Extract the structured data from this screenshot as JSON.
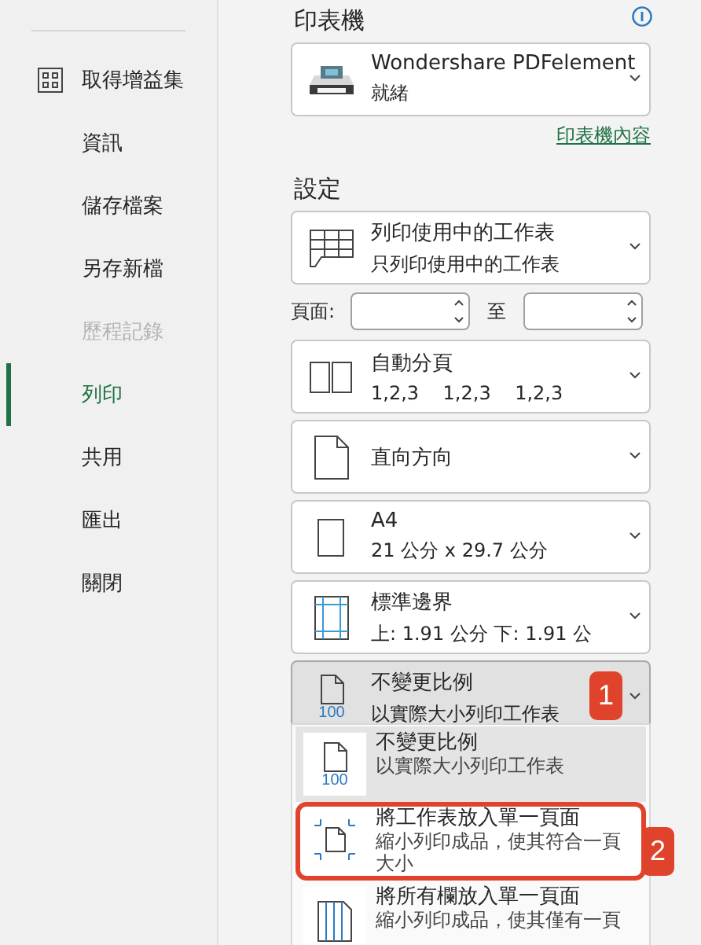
{
  "sidebar": {
    "items": [
      {
        "label": "取得增益集",
        "kind": "addins",
        "selected": false,
        "disabled": false
      },
      {
        "label": "資訊",
        "kind": "plain",
        "selected": false,
        "disabled": false
      },
      {
        "label": "儲存檔案",
        "kind": "plain",
        "selected": false,
        "disabled": false
      },
      {
        "label": "另存新檔",
        "kind": "plain",
        "selected": false,
        "disabled": false
      },
      {
        "label": "歷程記錄",
        "kind": "plain",
        "selected": false,
        "disabled": true
      },
      {
        "label": "列印",
        "kind": "plain",
        "selected": true,
        "disabled": false
      },
      {
        "label": "共用",
        "kind": "plain",
        "selected": false,
        "disabled": false
      },
      {
        "label": "匯出",
        "kind": "plain",
        "selected": false,
        "disabled": false
      },
      {
        "label": "關閉",
        "kind": "plain",
        "selected": false,
        "disabled": false
      }
    ]
  },
  "printer": {
    "heading": "印表機",
    "name": "Wondershare PDFelement",
    "status": "就緒",
    "link": "印表機內容"
  },
  "settings": {
    "heading": "設定",
    "rows": [
      {
        "kind": "dropdown",
        "title": "列印使用中的工作表",
        "subtitle": "只列印使用中的工作表",
        "pressed": false
      },
      {
        "kind": "pages",
        "label": "頁面:",
        "to": "至"
      },
      {
        "kind": "dropdown",
        "title": "自動分頁",
        "subtitle": "1,2,3    1,2,3    1,2,3",
        "pressed": false
      },
      {
        "kind": "dropdown",
        "title": "直向方向",
        "pressed": false
      },
      {
        "kind": "dropdown",
        "title": "A4",
        "subtitle": "21 公分 x 29.7 公分",
        "pressed": false
      },
      {
        "kind": "dropdown",
        "title": "標準邊界",
        "subtitle": "上: 1.91 公分 下: 1.91 公",
        "pressed": false
      },
      {
        "kind": "dropdown",
        "icon_label": "100",
        "title": "不變更比例",
        "subtitle": "以實際大小列印工作表",
        "pressed": true,
        "callout": "1"
      }
    ]
  },
  "menu": {
    "items": [
      {
        "icon_label": "100",
        "title": "不變更比例",
        "description": "以實際大小列印工作表",
        "selected": true,
        "highlight": false
      },
      {
        "title": "將工作表放入單一頁面",
        "description": "縮小列印成品，使其符合一頁大小",
        "selected": false,
        "highlight": true,
        "callout": "2"
      },
      {
        "title": "將所有欄放入單一頁面",
        "description": "縮小列印成品，使其僅有一頁",
        "selected": false,
        "highlight": false
      }
    ]
  }
}
